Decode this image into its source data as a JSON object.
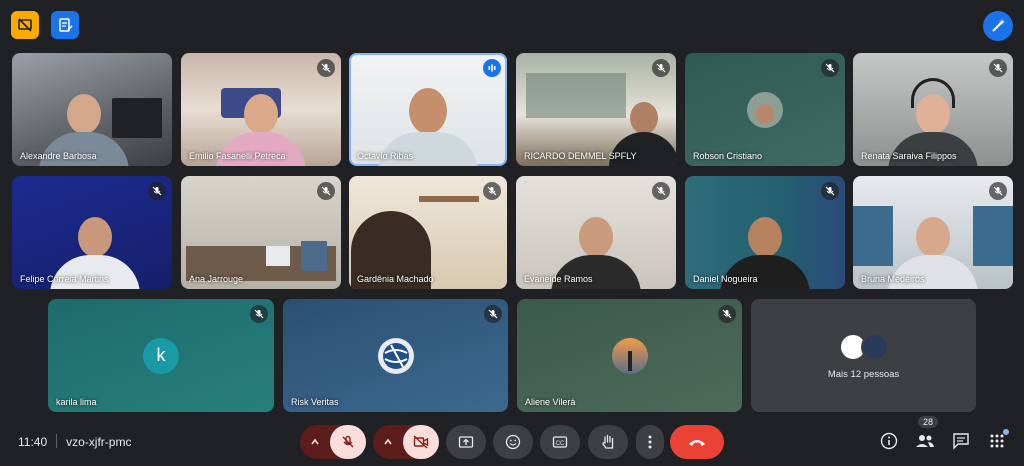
{
  "meeting": {
    "time": "11:40",
    "code": "vzo-xjfr-pmc",
    "people_count": "28"
  },
  "participants": [
    {
      "name": "Alexandre Barbosa",
      "muted": false
    },
    {
      "name": "Emilio Fasanelli Petreca",
      "muted": true
    },
    {
      "name": "Octavio Ribas",
      "muted": false,
      "speaking": true
    },
    {
      "name": "RICARDO DEMMEL SPFLY",
      "muted": true
    },
    {
      "name": "Robson Cristiano",
      "muted": true
    },
    {
      "name": "Renata Saraiva Filippos",
      "muted": true
    },
    {
      "name": "Felipe Correia Martins",
      "muted": true
    },
    {
      "name": "Ana Jarrouge",
      "muted": true
    },
    {
      "name": "Gardênia Machado",
      "muted": true
    },
    {
      "name": "Evaneide Ramos",
      "muted": true
    },
    {
      "name": "Daniel Nogueira",
      "muted": true
    },
    {
      "name": "Bruna Medeiros",
      "muted": true
    },
    {
      "name": "karila lima",
      "muted": true,
      "avatar_letter": "k"
    },
    {
      "name": "Risk Veritas",
      "muted": true
    },
    {
      "name": "Aliene Vilerá",
      "muted": true
    }
  ],
  "more_people": {
    "label": "Mais 12 pessoas"
  },
  "colors": {
    "background": "#202124",
    "accent": "#1a73e8",
    "hangup": "#ea4335",
    "muted_pill": "#f9dedc",
    "yellow_button": "#f9ab00"
  },
  "icons": {
    "top_left_1": "no-presentation-icon",
    "top_left_2": "edit-notes-icon",
    "top_right": "magic-pen-icon",
    "controls": [
      "caret-up-icon",
      "mic-off-icon",
      "caret-up-icon",
      "camera-off-icon",
      "present-screen-icon",
      "emoji-icon",
      "captions-icon",
      "raise-hand-icon",
      "more-vert-icon",
      "hangup-icon"
    ],
    "right": [
      "info-icon",
      "people-icon",
      "chat-icon",
      "activities-icon"
    ]
  }
}
